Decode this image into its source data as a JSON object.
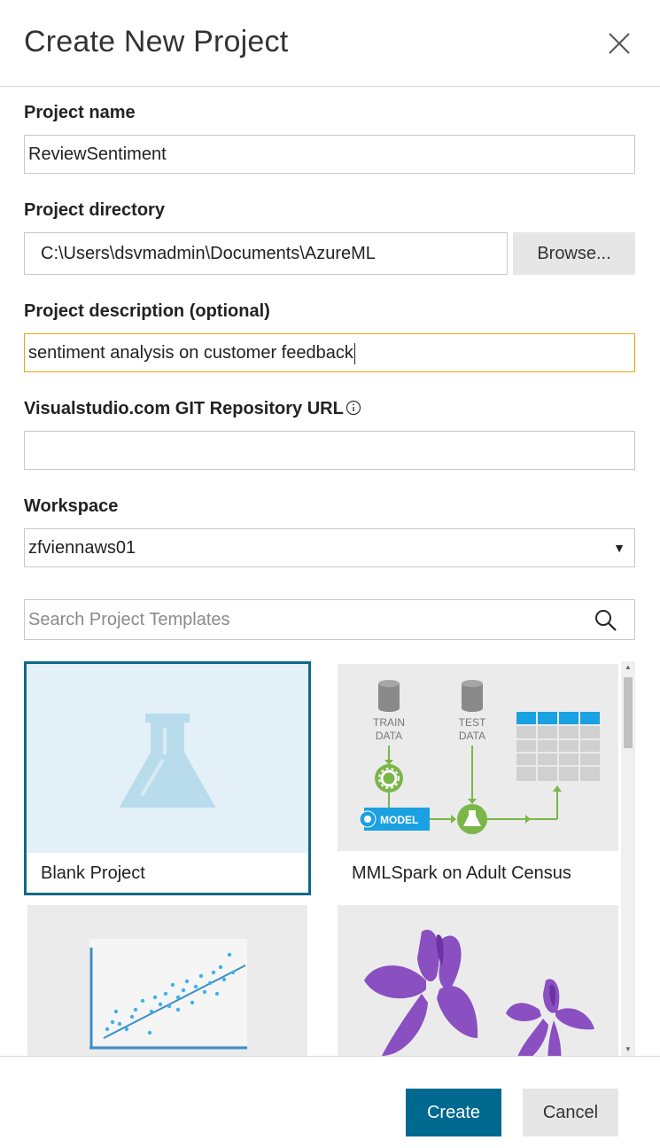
{
  "dialog": {
    "title": "Create New Project"
  },
  "form": {
    "project_name": {
      "label": "Project name",
      "value": "ReviewSentiment"
    },
    "project_directory": {
      "label": "Project directory",
      "value": "C:\\Users\\dsvmadmin\\Documents\\AzureML",
      "browse_label": "Browse..."
    },
    "project_description": {
      "label": "Project description (optional)",
      "value": "sentiment analysis on customer feedback"
    },
    "git_url": {
      "label": "Visualstudio.com GIT Repository URL",
      "value": ""
    },
    "workspace": {
      "label": "Workspace",
      "selected": "zfviennaws01"
    }
  },
  "search": {
    "placeholder": "Search Project Templates"
  },
  "templates": [
    {
      "label": "Blank Project",
      "selected": true
    },
    {
      "label": "MMLSpark on Adult Census",
      "diagram": {
        "train": "TRAIN\nDATA",
        "train_line1": "TRAIN",
        "train_line2": "DATA",
        "test_line1": "TEST",
        "test_line2": "DATA",
        "model": "MODEL"
      }
    },
    {
      "label": ""
    },
    {
      "label": ""
    }
  ],
  "footer": {
    "create_label": "Create",
    "cancel_label": "Cancel"
  },
  "colors": {
    "accent": "#00698f",
    "focus_border": "#e8a317",
    "selected_tile_border": "#0e6a85",
    "flask_fill": "#b9dcec",
    "diagram_green": "#7ab648",
    "diagram_blue": "#1aa1e1",
    "iris_purple": "#8a4fc0"
  }
}
